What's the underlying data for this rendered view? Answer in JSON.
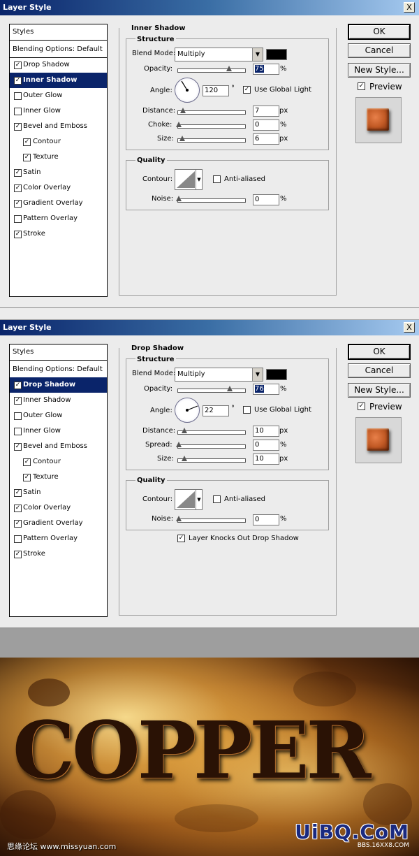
{
  "dialog1": {
    "title": "Layer Style",
    "close": "X",
    "styles_header": "Styles",
    "blending": "Blending Options: Default",
    "items": [
      {
        "label": "Drop Shadow",
        "checked": true,
        "selected": false,
        "indent": false
      },
      {
        "label": "Inner Shadow",
        "checked": true,
        "selected": true,
        "indent": false
      },
      {
        "label": "Outer Glow",
        "checked": false,
        "selected": false,
        "indent": false
      },
      {
        "label": "Inner Glow",
        "checked": false,
        "selected": false,
        "indent": false
      },
      {
        "label": "Bevel and Emboss",
        "checked": true,
        "selected": false,
        "indent": false
      },
      {
        "label": "Contour",
        "checked": true,
        "selected": false,
        "indent": true
      },
      {
        "label": "Texture",
        "checked": true,
        "selected": false,
        "indent": true
      },
      {
        "label": "Satin",
        "checked": true,
        "selected": false,
        "indent": false
      },
      {
        "label": "Color Overlay",
        "checked": true,
        "selected": false,
        "indent": false
      },
      {
        "label": "Gradient Overlay",
        "checked": true,
        "selected": false,
        "indent": false
      },
      {
        "label": "Pattern Overlay",
        "checked": false,
        "selected": false,
        "indent": false
      },
      {
        "label": "Stroke",
        "checked": true,
        "selected": false,
        "indent": false
      }
    ],
    "section": "Inner Shadow",
    "structure": "Structure",
    "blend_mode_label": "Blend Mode:",
    "blend_mode": "Multiply",
    "opacity_label": "Opacity:",
    "opacity": "75",
    "angle_label": "Angle:",
    "angle": "120",
    "degree": "°",
    "use_global_light": "Use Global Light",
    "use_global_light_checked": true,
    "distance_label": "Distance:",
    "distance": "7",
    "choke_label": "Choke:",
    "choke": "0",
    "size_label": "Size:",
    "size": "6",
    "quality": "Quality",
    "contour_label": "Contour:",
    "anti_aliased": "Anti-aliased",
    "noise_label": "Noise:",
    "noise": "0",
    "ok": "OK",
    "cancel": "Cancel",
    "new_style": "New Style...",
    "preview": "Preview",
    "pct": "%",
    "px": "px"
  },
  "dialog2": {
    "title": "Layer Style",
    "close": "X",
    "styles_header": "Styles",
    "blending": "Blending Options: Default",
    "items": [
      {
        "label": "Drop Shadow",
        "checked": true,
        "selected": true,
        "indent": false
      },
      {
        "label": "Inner Shadow",
        "checked": true,
        "selected": false,
        "indent": false
      },
      {
        "label": "Outer Glow",
        "checked": false,
        "selected": false,
        "indent": false
      },
      {
        "label": "Inner Glow",
        "checked": false,
        "selected": false,
        "indent": false
      },
      {
        "label": "Bevel and Emboss",
        "checked": true,
        "selected": false,
        "indent": false
      },
      {
        "label": "Contour",
        "checked": true,
        "selected": false,
        "indent": true
      },
      {
        "label": "Texture",
        "checked": true,
        "selected": false,
        "indent": true
      },
      {
        "label": "Satin",
        "checked": true,
        "selected": false,
        "indent": false
      },
      {
        "label": "Color Overlay",
        "checked": true,
        "selected": false,
        "indent": false
      },
      {
        "label": "Gradient Overlay",
        "checked": true,
        "selected": false,
        "indent": false
      },
      {
        "label": "Pattern Overlay",
        "checked": false,
        "selected": false,
        "indent": false
      },
      {
        "label": "Stroke",
        "checked": true,
        "selected": false,
        "indent": false
      }
    ],
    "section": "Drop Shadow",
    "structure": "Structure",
    "blend_mode_label": "Blend Mode:",
    "blend_mode": "Multiply",
    "opacity_label": "Opacity:",
    "opacity": "76",
    "angle_label": "Angle:",
    "angle": "22",
    "degree": "°",
    "use_global_light": "Use Global Light",
    "use_global_light_checked": false,
    "distance_label": "Distance:",
    "distance": "10",
    "spread_label": "Spread:",
    "spread": "0",
    "size_label": "Size:",
    "size": "10",
    "quality": "Quality",
    "contour_label": "Contour:",
    "anti_aliased": "Anti-aliased",
    "noise_label": "Noise:",
    "noise": "0",
    "knocks_out": "Layer Knocks Out Drop Shadow",
    "knocks_out_checked": true,
    "ok": "OK",
    "cancel": "Cancel",
    "new_style": "New Style...",
    "preview": "Preview",
    "pct": "%",
    "px": "px"
  },
  "artwork": {
    "text": "COPPER",
    "watermark_left": "思缘论坛 www.missyuan.com",
    "watermark_right": "UiBQ.CoM",
    "watermark_small": "BBS.16XX8.COM"
  },
  "colors": {
    "title_bar": "#0a246a",
    "selection": "#0a246a",
    "dialog_bg": "#ececec"
  }
}
